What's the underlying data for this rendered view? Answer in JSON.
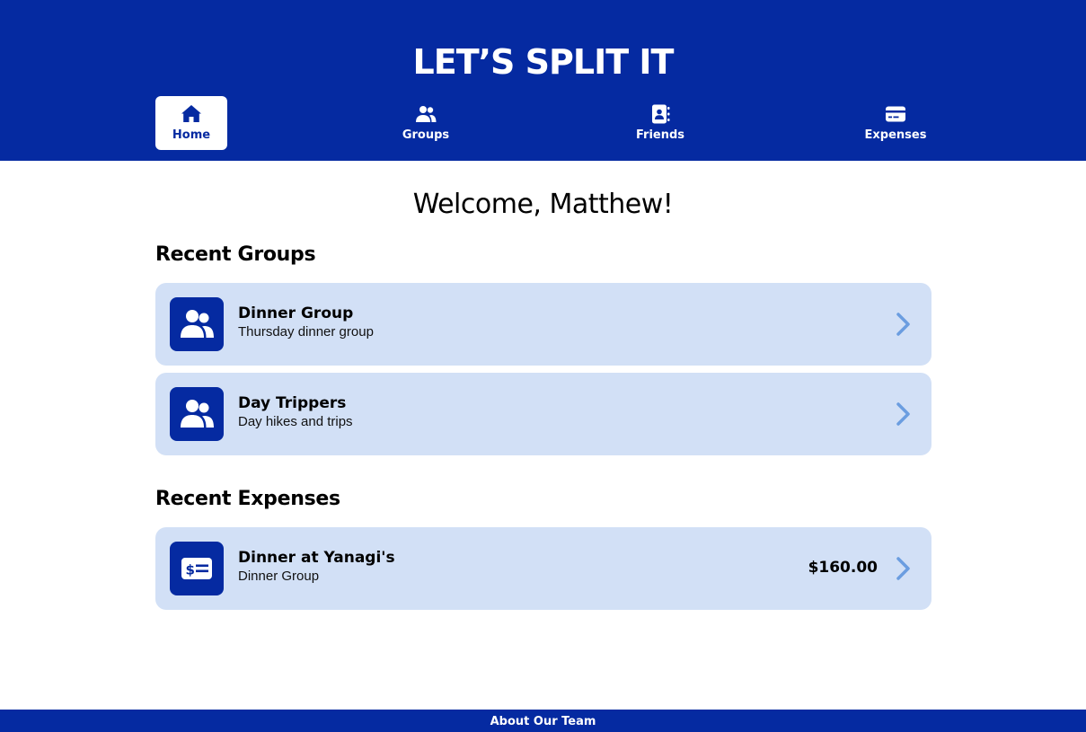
{
  "header": {
    "title": "LET’S SPLIT IT",
    "nav": [
      {
        "label": "Home",
        "icon": "home-icon",
        "active": true
      },
      {
        "label": "Groups",
        "icon": "users-icon",
        "active": false
      },
      {
        "label": "Friends",
        "icon": "address-book-icon",
        "active": false
      },
      {
        "label": "Expenses",
        "icon": "credit-card-icon",
        "active": false
      }
    ]
  },
  "main": {
    "welcome": "Welcome, Matthew!",
    "recent_groups_title": "Recent Groups",
    "groups": [
      {
        "name": "Dinner Group",
        "description": "Thursday dinner group",
        "icon": "users-icon"
      },
      {
        "name": "Day Trippers",
        "description": "Day hikes and trips",
        "icon": "users-icon"
      }
    ],
    "recent_expenses_title": "Recent Expenses",
    "expenses": [
      {
        "name": "Dinner at Yanagi's",
        "group": "Dinner Group",
        "amount": "$160.00",
        "icon": "money-bill-icon"
      }
    ]
  },
  "footer": {
    "link": "About Our Team"
  },
  "colors": {
    "brand": "#052aa1",
    "card_bg": "#d2e0f6",
    "chevron": "#6b9de0"
  }
}
